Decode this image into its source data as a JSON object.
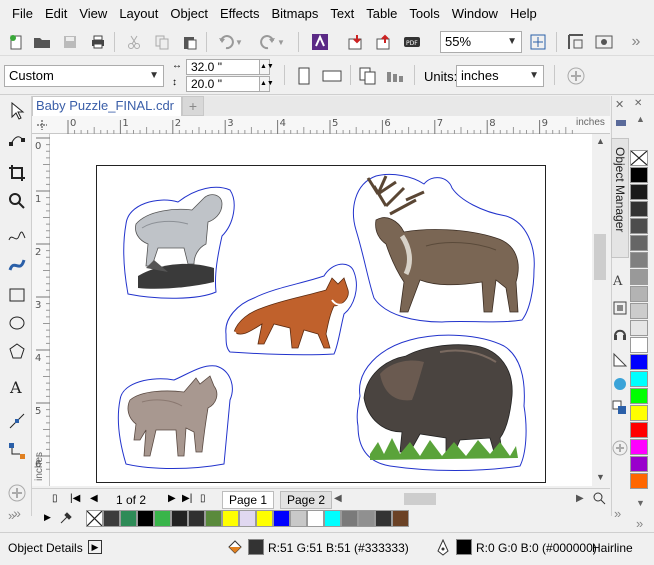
{
  "menu": [
    "File",
    "Edit",
    "View",
    "Layout",
    "Object",
    "Effects",
    "Bitmaps",
    "Text",
    "Table",
    "Tools",
    "Window",
    "Help"
  ],
  "menu_keys": [
    "F",
    "E",
    "V",
    "L",
    "O",
    "c",
    "B",
    "x",
    "T",
    "T",
    "W",
    "H"
  ],
  "toolbar": {
    "zoom": "55%",
    "overflow": "»"
  },
  "propbar": {
    "page_size": "Custom",
    "width": "32.0 \"",
    "height": "20.0 \"",
    "units_label": "Units:",
    "units_value": "inches"
  },
  "document": {
    "tab_title": "Baby Puzzle_FINAL.cdr",
    "new_tab": "+"
  },
  "ruler": {
    "unit": "inches",
    "h_ticks": [
      "0",
      "1",
      "2",
      "3",
      "4",
      "5",
      "6",
      "7",
      "8",
      "9"
    ],
    "v_ticks": [
      "0",
      "1",
      "2",
      "3",
      "4",
      "5",
      "6"
    ],
    "v_unit": "inches"
  },
  "pages": {
    "counter": "1 of 2",
    "tabs": [
      "Page 1",
      "Page 2"
    ]
  },
  "docker": {
    "title": "Object Manager"
  },
  "palette_v": [
    "none",
    "#000000",
    "#1a1a1a",
    "#333333",
    "#4d4d4d",
    "#666666",
    "#808080",
    "#999999",
    "#b3b3b3",
    "#cccccc",
    "#e6e6e6",
    "#ffffff",
    "#0000ff",
    "#00ffff",
    "#00ff00",
    "#ffff00",
    "#ff0000",
    "#ff00ff",
    "#9900cc",
    "#ff6600"
  ],
  "palette_h": [
    "none",
    "#3c3c3c",
    "#2e8b57",
    "#000000",
    "#39b54a",
    "#222222",
    "#303030",
    "#5a8a3c",
    "#ffff00",
    "#e0d8f0",
    "#ffff00",
    "#0000ff",
    "#c8c8c8",
    "#ffffff",
    "#00ffff",
    "#7a7a7a",
    "#909090",
    "#333333",
    "#6b4226"
  ],
  "status": {
    "object_details": "Object Details",
    "fill_label": "R:51 G:51 B:51 (#333333)",
    "fill_color": "#333333",
    "outline_label": "R:0 G:0 B:0 (#000000)",
    "outline_color": "#000000",
    "outline_width": "Hairline"
  }
}
